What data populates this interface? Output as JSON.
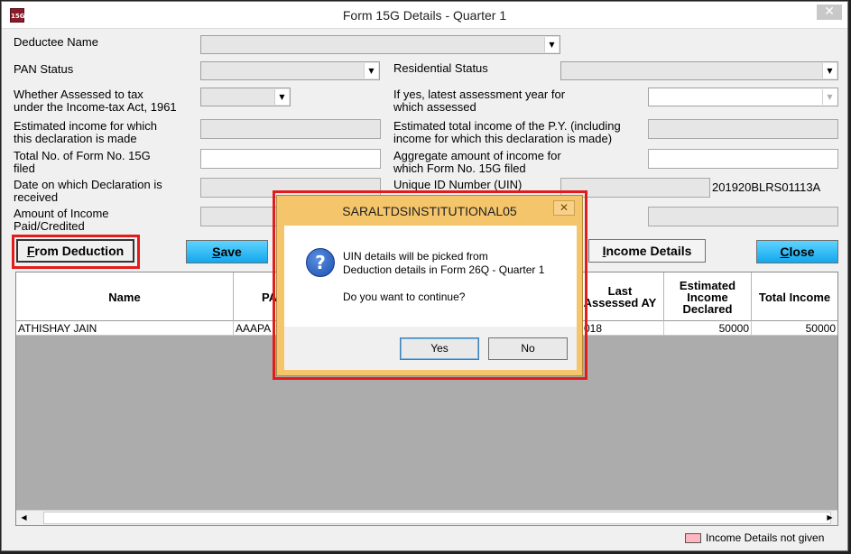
{
  "window": {
    "title": "Form 15G Details - Quarter 1",
    "app_icon": "15G",
    "close_glyph": "✕"
  },
  "form": {
    "deductee_name_label": "Deductee Name",
    "pan_status_label": "PAN Status",
    "residential_status_label": "Residential Status",
    "assessed_label_1": "Whether Assessed to tax",
    "assessed_label_2": "under the Income-tax Act, 1961",
    "latest_ay_label_1": "If yes, latest assessment year for",
    "latest_ay_label_2": "which assessed",
    "est_income_label_1": "Estimated income for which",
    "est_income_label_2": "this declaration is made",
    "est_total_label_1": "Estimated total income of the P.Y. (including",
    "est_total_label_2": "income for which this declaration is made)",
    "total_forms_label_1": "Total No. of Form No. 15G",
    "total_forms_label_2": "filed",
    "aggregate_label_1": "Aggregate amount of income for",
    "aggregate_label_2": "which Form No. 15G filed",
    "date_label_1": "Date on which Declaration is",
    "date_label_2": "received",
    "uin_label": "Unique ID Number (UIN)",
    "uin_value": "201920BLRS01113A",
    "amount_paid_label_1": "Amount of Income",
    "amount_paid_label_2": "Paid/Credited"
  },
  "buttons": {
    "from_deduction_mnemonic": "F",
    "from_deduction_rest": "rom Deduction",
    "save_mnemonic": "S",
    "save_rest": "ave",
    "income_details_mnemonic": "I",
    "income_details_rest": "ncome Details",
    "close_mnemonic": "C",
    "close_rest": "lose"
  },
  "grid": {
    "headers": {
      "name": "Name",
      "pan": "PA",
      "last_ay_1": "Last",
      "last_ay_2": "Assessed AY",
      "est_1": "Estimated",
      "est_2": "Income",
      "est_3": "Declared",
      "total": "Total Income"
    },
    "rows": [
      {
        "name": "ATHISHAY JAIN",
        "pan": "AAAPA",
        "last_ay": "018",
        "est_income": "50000",
        "total_income": "50000"
      }
    ]
  },
  "legend": {
    "text": "Income Details not given",
    "color": "#ffb6c1"
  },
  "dialog": {
    "title": "SARALTDSINSTITUTIONAL05",
    "close_glyph": "✕",
    "icon": "question-icon",
    "message_line_1": "UIN details will be picked from",
    "message_line_2": "Deduction details in Form 26Q - Quarter 1",
    "message_line_3": "Do you want to continue?",
    "yes_label": "Yes",
    "no_label": "No"
  },
  "colors": {
    "accent_button": "#12a7ee",
    "dialog_frame": "#f4c56a",
    "highlight": "#e21c1c"
  }
}
